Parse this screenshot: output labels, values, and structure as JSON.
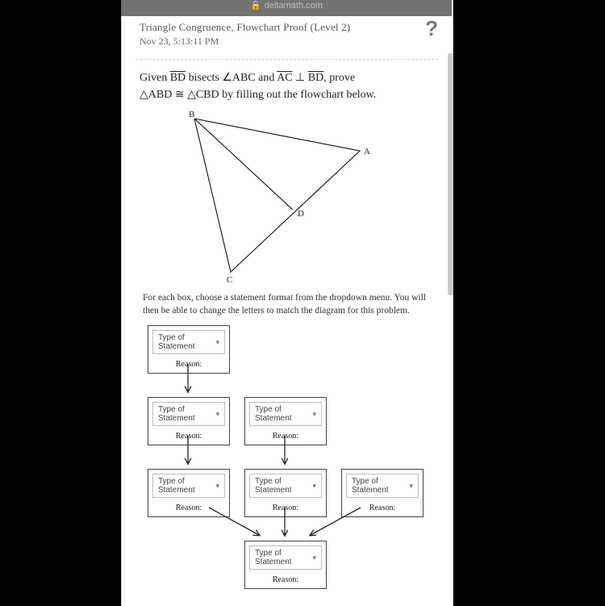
{
  "url": {
    "host": "deltamath.com",
    "lock_glyph": "🔒"
  },
  "header": {
    "topic": "Triangle Congruence, Flowchart Proof (Level 2)",
    "timestamp": "Nov 23, 5:13:11 PM",
    "help_glyph": "?"
  },
  "prompt": {
    "pre1": "Given ",
    "seg1": "BD",
    "mid1": " bisects ",
    "ang": "∠ABC",
    "mid2": " and ",
    "seg2": "AC",
    "perp": " ⊥ ",
    "seg3": "BD",
    "post1": ", prove",
    "tri1": "△ABD",
    "cong": " ≅ ",
    "tri2": "△CBD",
    "post2": " by filling out the flowchart below."
  },
  "figure": {
    "labels": {
      "A": "A",
      "B": "B",
      "C": "C",
      "D": "D"
    }
  },
  "instructions": "For each box, choose a statement format from the dropdown menu. You will then be able to change the letters to match the diagram for this problem.",
  "flow": {
    "placeholder": "Type of Statement",
    "reason_label": "Reason:"
  }
}
